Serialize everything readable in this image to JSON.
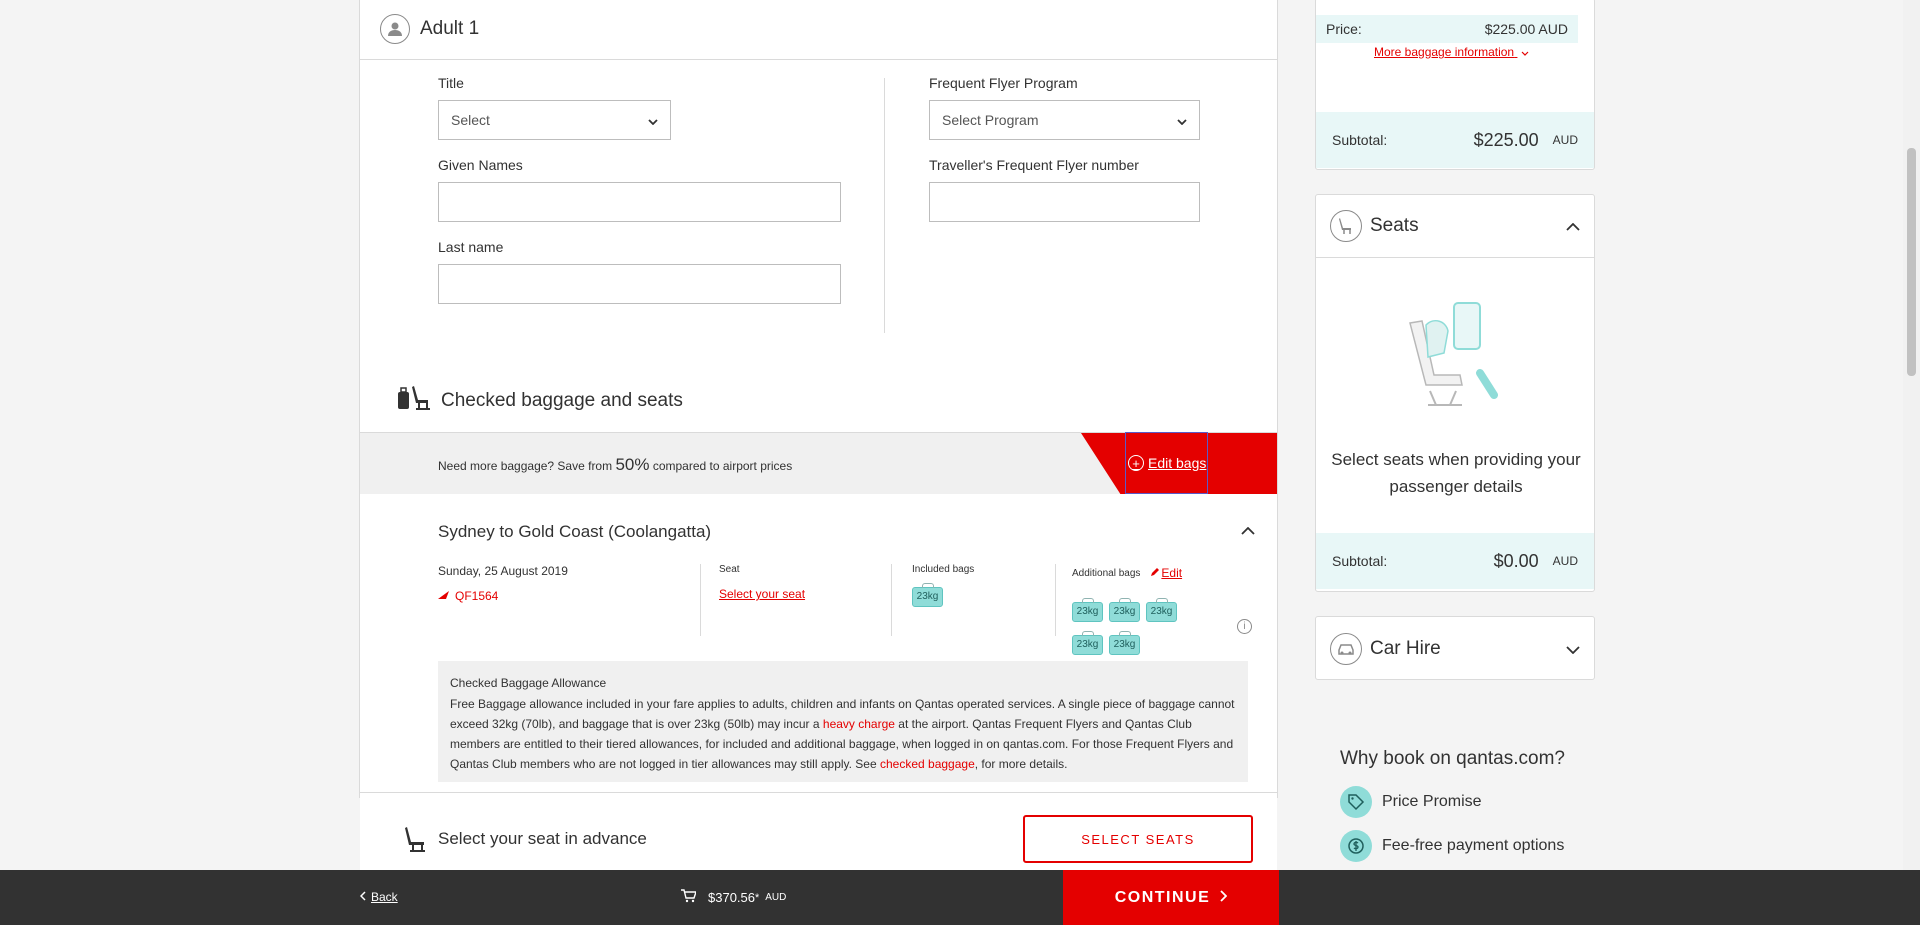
{
  "passenger": {
    "heading": "Adult 1",
    "title_label": "Title",
    "title_value": "Select",
    "given_names_label": "Given Names",
    "last_name_label": "Last name",
    "ff_program_label": "Frequent Flyer Program",
    "ff_program_value": "Select Program",
    "ff_number_label": "Traveller's Frequent Flyer number"
  },
  "baggage_section": {
    "title": "Checked baggage and seats",
    "promo_prefix": "Need more baggage? Save from ",
    "promo_percent": "50%",
    "promo_suffix": " compared to airport prices",
    "edit_bags_label": "Edit bags"
  },
  "flight": {
    "route": "Sydney to Gold Coast (Coolangatta)",
    "date": "Sunday, 25 August 2019",
    "flight_number": "QF1564",
    "seat_label": "Seat",
    "seat_link": "Select your seat",
    "included_bags_label": "Included bags",
    "included_bags": [
      "23kg"
    ],
    "additional_bags_label": "Additional bags",
    "edit_label": "Edit",
    "additional_bags": [
      "23kg",
      "23kg",
      "23kg",
      "23kg",
      "23kg"
    ]
  },
  "allowance": {
    "title": "Checked Baggage Allowance",
    "text_1": "Free Baggage allowance included in your fare applies to adults, children and infants on Qantas operated services. A single piece of baggage cannot exceed 32kg (70lb), and baggage that is over 23kg (50lb) may incur a ",
    "link_1": "heavy charge",
    "text_2": " at the airport. Qantas Frequent Flyers and Qantas Club members are entitled to their tiered allowances, for included and additional baggage, when logged in on qantas.com. For those Frequent Flyers and Qantas Club members who are not logged in tier allowances may still apply. See ",
    "link_2": "checked baggage",
    "text_3": ", for more details."
  },
  "seat_advance": {
    "title": "Select your seat in advance",
    "button": "SELECT SEATS"
  },
  "sidebar": {
    "price_label": "Price:",
    "price_value": "$225.00 AUD",
    "more_baggage": "More baggage information",
    "baggage_subtotal_label": "Subtotal:",
    "baggage_subtotal_amount": "$225.00",
    "baggage_subtotal_currency": "AUD",
    "seats_title": "Seats",
    "seats_message": "Select seats when providing your passenger details",
    "seats_subtotal_label": "Subtotal:",
    "seats_subtotal_amount": "$0.00",
    "seats_subtotal_currency": "AUD",
    "car_hire_title": "Car Hire",
    "why_title": "Why book on qantas.com?",
    "benefits": [
      "Price Promise",
      "Fee-free payment options"
    ]
  },
  "bottom_bar": {
    "back_label": "Back",
    "total": "$370.56",
    "total_mark": "*",
    "currency": "AUD",
    "continue_label": "CONTINUE"
  },
  "colors": {
    "accent_red": "#e40000",
    "teal": "#8fdcd8",
    "dark_bar": "#323232"
  }
}
